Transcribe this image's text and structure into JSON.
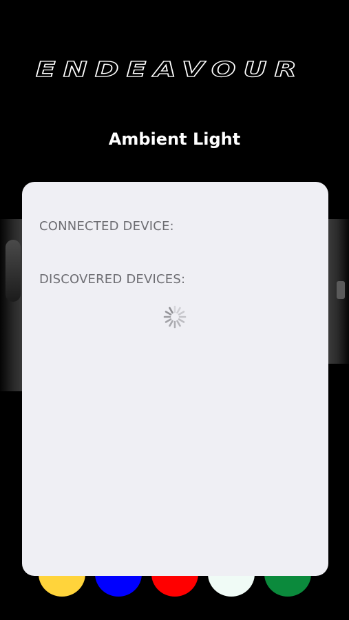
{
  "brand": {
    "logo_text": "ENDEAVOUR"
  },
  "header": {
    "title": "Ambient Light"
  },
  "panel": {
    "connected_label": "CONNECTED DEVICE:",
    "discovered_label": "DISCOVERED DEVICES:",
    "loading_icon": "activity-spinner-icon"
  },
  "colors": {
    "background": "#000000",
    "panel": "#efeff4",
    "label": "#6d6d72",
    "swatches": [
      "#ffd43b",
      "#0000ff",
      "#ff0000",
      "#f0fbf6",
      "#0b8a3c"
    ]
  }
}
